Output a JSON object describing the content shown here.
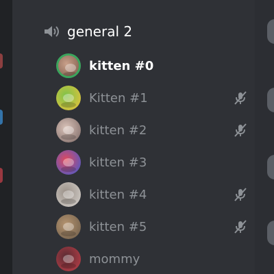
{
  "voice_channel": {
    "name": "general 2"
  },
  "users": [
    {
      "name": "kitten #0",
      "active": true,
      "speaking": true,
      "muted": false,
      "colors": [
        "#7a5a4a",
        "#c9a08a"
      ]
    },
    {
      "name": "Kitten #1",
      "active": false,
      "speaking": false,
      "muted": true,
      "colors": [
        "#f0c23a",
        "#7dc24a"
      ]
    },
    {
      "name": "kitten #2",
      "active": false,
      "speaking": false,
      "muted": true,
      "colors": [
        "#7a6663",
        "#d9c2b8"
      ]
    },
    {
      "name": "kitten #3",
      "active": false,
      "speaking": false,
      "muted": false,
      "colors": [
        "#3b5bd6",
        "#e14a5c"
      ]
    },
    {
      "name": "kitten #4",
      "active": false,
      "speaking": false,
      "muted": true,
      "colors": [
        "#d8d4cf",
        "#9a9088"
      ]
    },
    {
      "name": "kitten #5",
      "active": false,
      "speaking": false,
      "muted": true,
      "colors": [
        "#6a5a48",
        "#b59470"
      ]
    },
    {
      "name": "mommy",
      "active": false,
      "speaking": false,
      "muted": false,
      "colors": [
        "#c2404a",
        "#5a2c33"
      ]
    }
  ],
  "icons": {
    "speaker": "speaker-icon",
    "mute": "mic-muted-icon"
  },
  "colors": {
    "accent_speaking": "#3ba55d",
    "panel": "#2f3136",
    "text_active": "#ffffff",
    "text_muted": "#8e9297"
  }
}
